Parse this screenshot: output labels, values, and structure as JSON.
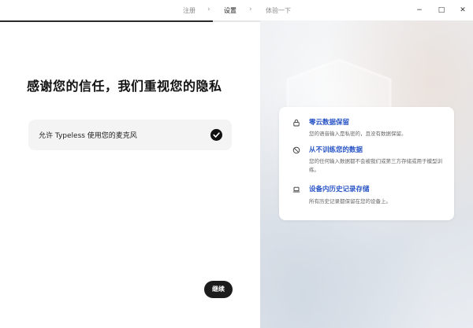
{
  "steps": [
    {
      "label": "注册",
      "active": false
    },
    {
      "label": "设置",
      "active": true
    },
    {
      "label": "体验一下",
      "active": false
    }
  ],
  "window_controls": {
    "minimize": "−",
    "maximize": "□",
    "close": "✕"
  },
  "progress": {
    "fraction": 0.45
  },
  "main": {
    "heading": "感谢您的信任，我们重视您的隐私",
    "permission": {
      "label": "允许 Typeless 使用您的麦克风",
      "checked": true
    },
    "continue_label": "继续"
  },
  "privacy": {
    "items": [
      {
        "icon": "lock-icon",
        "title": "零云数据保留",
        "desc": "您的语音输入是私密的，且没有数据保留。"
      },
      {
        "icon": "ban-icon",
        "title": "从不训练您的数据",
        "desc": "您的任何输入数据都不会被我们或第三方存储或用于模型训练。"
      },
      {
        "icon": "laptop-icon",
        "title": "设备内历史记录存储",
        "desc": "所有历史记录都保留在您的设备上。"
      }
    ]
  },
  "colors": {
    "accent": "#2a56c6",
    "button": "#1c1c1c"
  }
}
